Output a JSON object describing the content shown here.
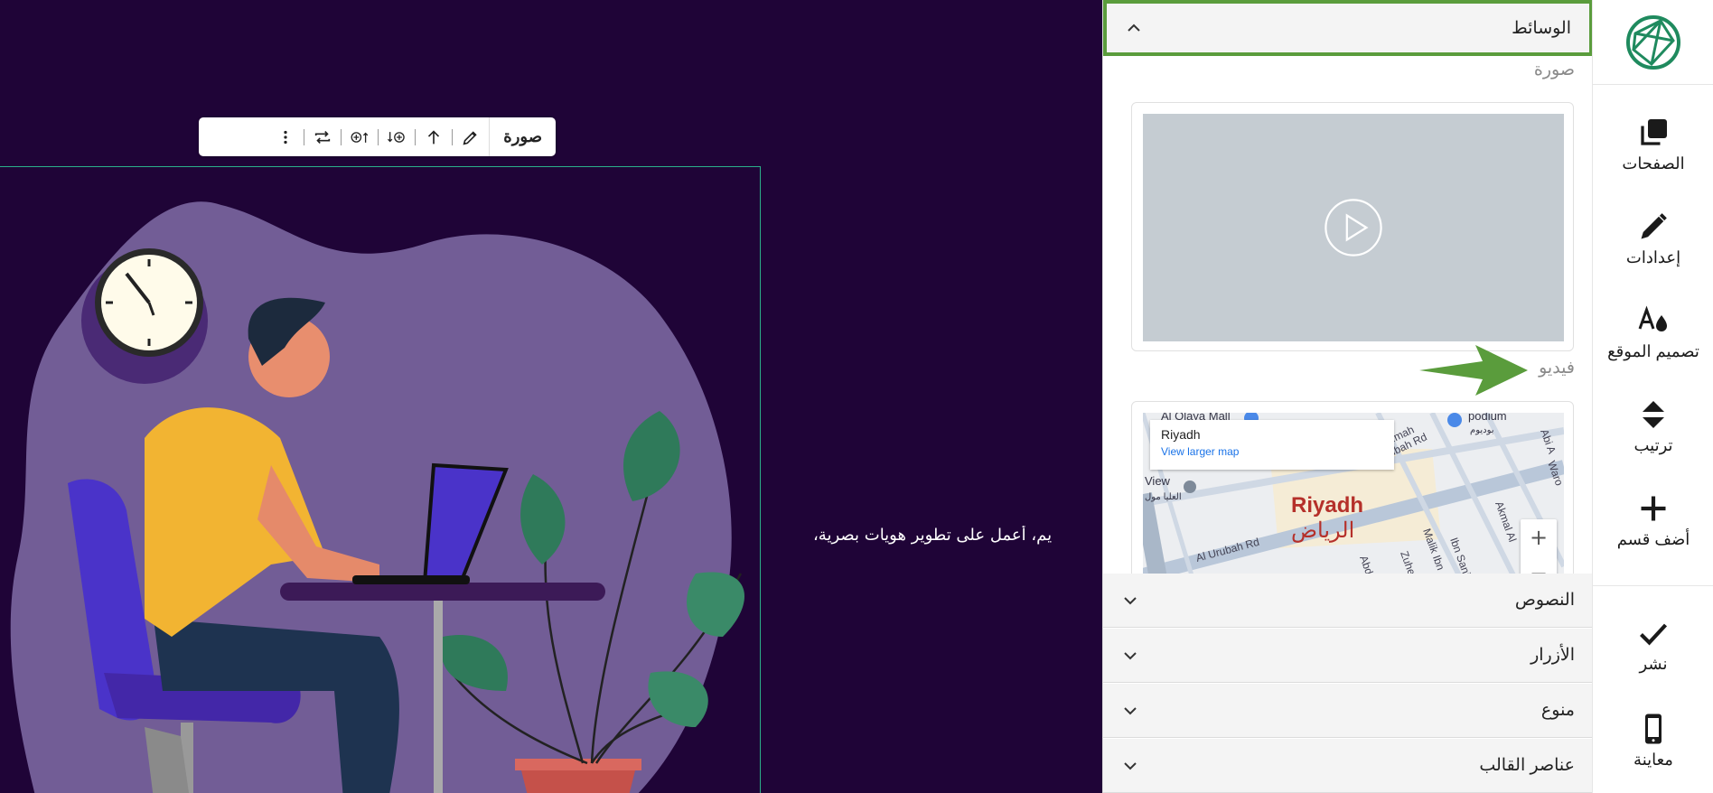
{
  "canvas": {
    "text": "يم، أعمل على تطوير هويات بصرية،",
    "toolbar": {
      "label": "صورة"
    }
  },
  "panel": {
    "media": {
      "title": "الوسائط",
      "image_label": "صورة",
      "video_label": "فيديو",
      "map": {
        "info_title": "Riyadh",
        "info_link": "View larger map",
        "city_en": "Riyadh",
        "city_ar": "الرياض",
        "streets": [
          "Al Olaya Mall",
          "podium",
          "بوديوم",
          "Al Urubah Rd",
          "Al Urubah Rd",
          "Abdull",
          "Malik Ibn",
          "Ibn Sani",
          "Akmal Al",
          "Zuhe",
          "Abi A",
          "Waro",
          "Rmah",
          "View",
          "العليا مول"
        ],
        "zoom_in": "+",
        "zoom_out": "−"
      }
    },
    "sections": [
      {
        "title": "النصوص"
      },
      {
        "title": "الأزرار"
      },
      {
        "title": "منوع"
      },
      {
        "title": "عناصر القالب"
      }
    ]
  },
  "rail": {
    "items": [
      {
        "label": "الصفحات",
        "icon": "pages-icon"
      },
      {
        "label": "إعدادات",
        "icon": "pencil-icon"
      },
      {
        "label": "تصميم الموقع",
        "icon": "design-icon"
      },
      {
        "label": "ترتيب",
        "icon": "sort-icon"
      },
      {
        "label": "أضف قسم",
        "icon": "plus-icon"
      },
      {
        "label": "نشر",
        "icon": "check-icon"
      },
      {
        "label": "معاينة",
        "icon": "mobile-icon"
      }
    ]
  },
  "colors": {
    "canvas_bg": "#1f0437",
    "blob": "#725d96",
    "accent_green": "#5a9c3c",
    "brand": "#1f8a5e"
  }
}
